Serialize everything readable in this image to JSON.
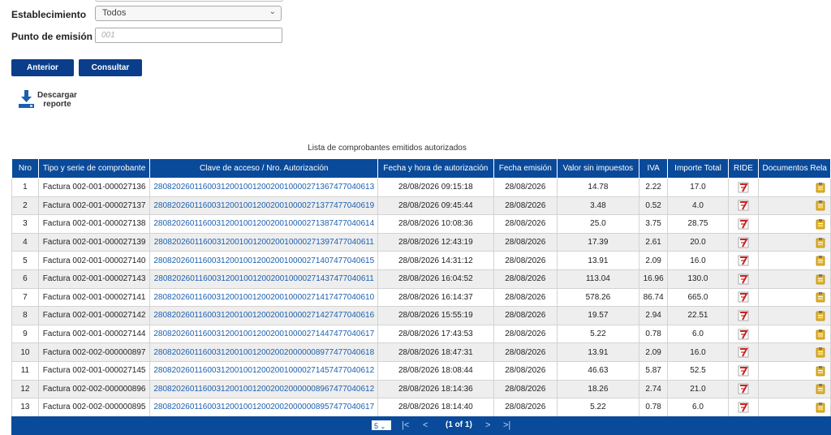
{
  "form": {
    "establecimiento_label": "Establecimiento",
    "establecimiento_value": "Todos",
    "punto_label": "Punto de emisión",
    "punto_placeholder": "001"
  },
  "buttons": {
    "anterior": "Anterior",
    "consultar": "Consultar"
  },
  "download": {
    "line1": "Descargar",
    "line2": "reporte"
  },
  "table": {
    "caption": "Lista de comprobantes emitidos autorizados",
    "headers": [
      "Nro",
      "Tipo y serie de comprobante",
      "Clave de acceso / Nro. Autorización",
      "Fecha y hora de autorización",
      "Fecha emisión",
      "Valor sin impuestos",
      "IVA",
      "Importe Total",
      "RIDE",
      "Documentos Rela"
    ],
    "rows": [
      {
        "nro": "1",
        "tipo": "Factura 002-001-000027136",
        "clave": "2808202601160031200100120020010000271367477040613",
        "fecha_hora": "28/08/2026 09:15:18",
        "fecha": "28/08/2026",
        "valor": "14.78",
        "iva": "2.22",
        "total": "17.0"
      },
      {
        "nro": "2",
        "tipo": "Factura 002-001-000027137",
        "clave": "2808202601160031200100120020010000271377477040619",
        "fecha_hora": "28/08/2026 09:45:44",
        "fecha": "28/08/2026",
        "valor": "3.48",
        "iva": "0.52",
        "total": "4.0"
      },
      {
        "nro": "3",
        "tipo": "Factura 002-001-000027138",
        "clave": "2808202601160031200100120020010000271387477040614",
        "fecha_hora": "28/08/2026 10:08:36",
        "fecha": "28/08/2026",
        "valor": "25.0",
        "iva": "3.75",
        "total": "28.75"
      },
      {
        "nro": "4",
        "tipo": "Factura 002-001-000027139",
        "clave": "2808202601160031200100120020010000271397477040611",
        "fecha_hora": "28/08/2026 12:43:19",
        "fecha": "28/08/2026",
        "valor": "17.39",
        "iva": "2.61",
        "total": "20.0"
      },
      {
        "nro": "5",
        "tipo": "Factura 002-001-000027140",
        "clave": "2808202601160031200100120020010000271407477040615",
        "fecha_hora": "28/08/2026 14:31:12",
        "fecha": "28/08/2026",
        "valor": "13.91",
        "iva": "2.09",
        "total": "16.0"
      },
      {
        "nro": "6",
        "tipo": "Factura 002-001-000027143",
        "clave": "2808202601160031200100120020010000271437477040611",
        "fecha_hora": "28/08/2026 16:04:52",
        "fecha": "28/08/2026",
        "valor": "113.04",
        "iva": "16.96",
        "total": "130.0"
      },
      {
        "nro": "7",
        "tipo": "Factura 002-001-000027141",
        "clave": "2808202601160031200100120020010000271417477040610",
        "fecha_hora": "28/08/2026 16:14:37",
        "fecha": "28/08/2026",
        "valor": "578.26",
        "iva": "86.74",
        "total": "665.0"
      },
      {
        "nro": "8",
        "tipo": "Factura 002-001-000027142",
        "clave": "2808202601160031200100120020010000271427477040616",
        "fecha_hora": "28/08/2026 15:55:19",
        "fecha": "28/08/2026",
        "valor": "19.57",
        "iva": "2.94",
        "total": "22.51"
      },
      {
        "nro": "9",
        "tipo": "Factura 002-001-000027144",
        "clave": "2808202601160031200100120020010000271447477040617",
        "fecha_hora": "28/08/2026 17:43:53",
        "fecha": "28/08/2026",
        "valor": "5.22",
        "iva": "0.78",
        "total": "6.0"
      },
      {
        "nro": "10",
        "tipo": "Factura 002-002-000000897",
        "clave": "2808202601160031200100120020020000008977477040618",
        "fecha_hora": "28/08/2026 18:47:31",
        "fecha": "28/08/2026",
        "valor": "13.91",
        "iva": "2.09",
        "total": "16.0"
      },
      {
        "nro": "11",
        "tipo": "Factura 002-001-000027145",
        "clave": "2808202601160031200100120020010000271457477040612",
        "fecha_hora": "28/08/2026 18:08:44",
        "fecha": "28/08/2026",
        "valor": "46.63",
        "iva": "5.87",
        "total": "52.5"
      },
      {
        "nro": "12",
        "tipo": "Factura 002-002-000000896",
        "clave": "2808202601160031200100120020020000008967477040612",
        "fecha_hora": "28/08/2026 18:14:36",
        "fecha": "28/08/2026",
        "valor": "18.26",
        "iva": "2.74",
        "total": "21.0"
      },
      {
        "nro": "13",
        "tipo": "Factura 002-002-000000895",
        "clave": "2808202601160031200100120020020000008957477040617",
        "fecha_hora": "28/08/2026 18:14:40",
        "fecha": "28/08/2026",
        "valor": "5.22",
        "iva": "0.78",
        "total": "6.0"
      }
    ]
  },
  "pager": {
    "page_size": "5",
    "first": "|<",
    "prev": "<",
    "info": "(1 of 1)",
    "next": ">",
    "last": ">|"
  },
  "icons": {
    "ride": "pdf-icon",
    "docs": "clipboard-icon",
    "download": "download-icon"
  },
  "colors": {
    "primary": "#0a3e8a",
    "header": "#0a4a9a",
    "link": "#1b5fb0",
    "pdf": "#cc2222",
    "clipboard": "#e6b422"
  }
}
